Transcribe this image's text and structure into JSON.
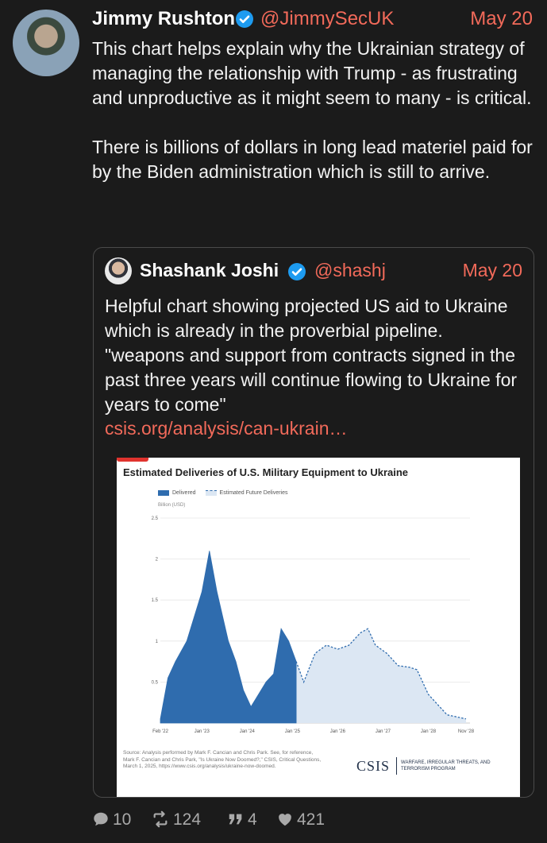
{
  "tweet": {
    "author_name": "Jimmy Rushton",
    "handle": "@JimmySecUK",
    "date": "May 20",
    "text": "This chart helps explain why the Ukrainian strategy of managing the relationship with Trump - as frustrating and unproductive as it might seem to many - is critical.\n\nThere is billions of dollars in long lead materiel paid for by the Biden administration which is still to arrive."
  },
  "quote": {
    "author_name": "Shashank Joshi",
    "handle": "@shashj",
    "date": "May 20",
    "text": "Helpful chart showing projected US aid to Ukraine which is already in the proverbial pipeline. \"weapons and support from contracts signed in the past three years will continue flowing to Ukraine for years to come\"",
    "link": "csis.org/analysis/can-ukrain…"
  },
  "chart_image": {
    "source_note": "Source: Analysis performed by Mark F. Cancian and Chris Park. See, for reference, Mark F. Cancian and Chris Park, \"Is Ukraine Now Doomed?,\" CSIS, Critical Questions, March 1, 2025, https://www.csis.org/analysis/ukraine-now-doomed.",
    "logo_text": "CSIS",
    "logo_tagline": "WARFARE, IRREGULAR THREATS, AND TERRORISM PROGRAM"
  },
  "chart_data": {
    "type": "area",
    "title": "Estimated Deliveries of U.S. Military Equipment to Ukraine",
    "ylabel": "Billion (USD)",
    "xlabel": "",
    "ylim": [
      0,
      2.5
    ],
    "yticks": [
      "2.5",
      "2",
      "1.5",
      "1",
      "0.5"
    ],
    "xticks": [
      "Feb '22",
      "Jan '23",
      "Jan '24",
      "Jan '25",
      "Jan '26",
      "Jan '27",
      "Jan '28",
      "Nov '28"
    ],
    "legend_position": "top-left",
    "grid": true,
    "series": [
      {
        "name": "Delivered",
        "color": "#2f6cae",
        "style": "solid-area",
        "points": [
          [
            "2022-02",
            0.05
          ],
          [
            "2022-04",
            0.55
          ],
          [
            "2022-06",
            0.75
          ],
          [
            "2022-09",
            1.0
          ],
          [
            "2022-11",
            1.3
          ],
          [
            "2023-01",
            1.6
          ],
          [
            "2023-03",
            2.1
          ],
          [
            "2023-05",
            1.6
          ],
          [
            "2023-08",
            1.0
          ],
          [
            "2023-10",
            0.75
          ],
          [
            "2023-12",
            0.4
          ],
          [
            "2024-02",
            0.2
          ],
          [
            "2024-04",
            0.35
          ],
          [
            "2024-06",
            0.5
          ],
          [
            "2024-08",
            0.6
          ],
          [
            "2024-10",
            1.15
          ],
          [
            "2024-12",
            1.0
          ],
          [
            "2025-02",
            0.75
          ]
        ]
      },
      {
        "name": "Estimated Future Deliveries",
        "color": "#2f6cae",
        "style": "dashed-light-area",
        "points": [
          [
            "2025-02",
            0.75
          ],
          [
            "2025-04",
            0.5
          ],
          [
            "2025-07",
            0.85
          ],
          [
            "2025-10",
            0.95
          ],
          [
            "2026-01",
            0.9
          ],
          [
            "2026-04",
            0.95
          ],
          [
            "2026-07",
            1.1
          ],
          [
            "2026-09",
            1.15
          ],
          [
            "2026-11",
            0.95
          ],
          [
            "2027-02",
            0.85
          ],
          [
            "2027-05",
            0.7
          ],
          [
            "2027-08",
            0.68
          ],
          [
            "2027-10",
            0.65
          ],
          [
            "2028-01",
            0.35
          ],
          [
            "2028-04",
            0.2
          ],
          [
            "2028-06",
            0.1
          ],
          [
            "2028-11",
            0.05
          ]
        ]
      }
    ]
  },
  "actions": {
    "replies": "10",
    "reposts": "124",
    "quotes": "4",
    "likes": "421"
  },
  "colors": {
    "accent": "#f26a5a",
    "background": "#1b1b1b",
    "verified": "#1d9bf0"
  }
}
